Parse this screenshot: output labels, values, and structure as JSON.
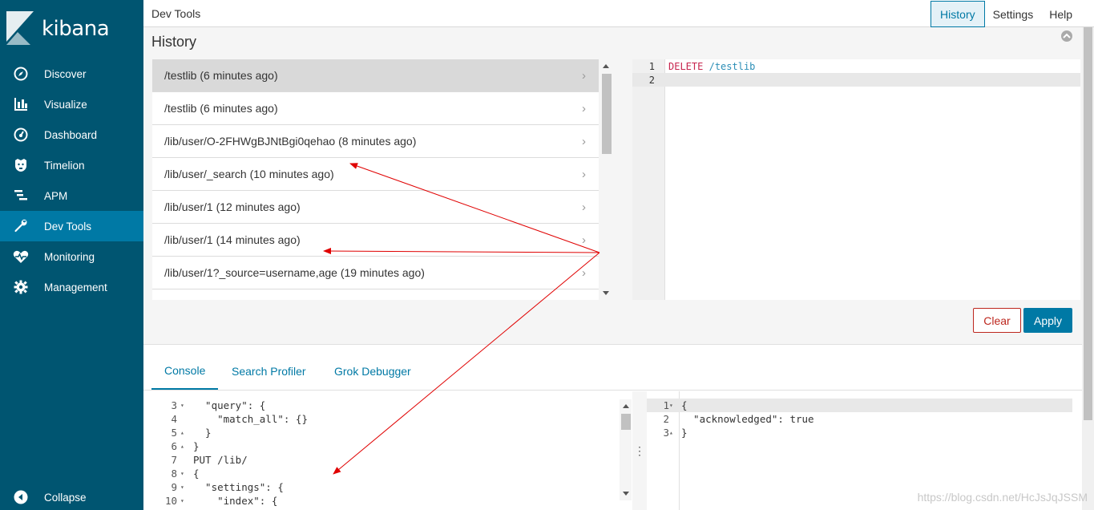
{
  "app": {
    "logo_text": "kibana"
  },
  "sidebar": {
    "items": [
      {
        "label": "Discover",
        "icon": "compass-icon"
      },
      {
        "label": "Visualize",
        "icon": "bar-chart-icon"
      },
      {
        "label": "Dashboard",
        "icon": "dashboard-icon"
      },
      {
        "label": "Timelion",
        "icon": "timelion-icon"
      },
      {
        "label": "APM",
        "icon": "apm-icon"
      },
      {
        "label": "Dev Tools",
        "icon": "wrench-icon",
        "active": true
      },
      {
        "label": "Monitoring",
        "icon": "heartbeat-icon"
      },
      {
        "label": "Management",
        "icon": "gear-icon"
      }
    ],
    "collapse_label": "Collapse"
  },
  "topbar": {
    "title": "Dev Tools",
    "nav": {
      "history": "History",
      "settings": "Settings",
      "help": "Help"
    }
  },
  "history": {
    "title": "History",
    "items": [
      "/testlib (6 minutes ago)",
      "/testlib (6 minutes ago)",
      "/lib/user/O-2FHWgBJNtBgi0qehao (8 minutes ago)",
      "/lib/user/_search (10 minutes ago)",
      "/lib/user/1 (12 minutes ago)",
      "/lib/user/1 (14 minutes ago)",
      "/lib/user/1?_source=username,age (19 minutes ago)"
    ],
    "preview": {
      "lines": [
        {
          "num": "1",
          "method": "DELETE",
          "path": "/testlib"
        },
        {
          "num": "2",
          "method": "",
          "path": ""
        }
      ]
    },
    "clear_label": "Clear",
    "apply_label": "Apply"
  },
  "tabs": {
    "console": "Console",
    "search_profiler": "Search Profiler",
    "grok_debugger": "Grok Debugger"
  },
  "editor": {
    "lines": [
      {
        "num": "3",
        "fold": "▾",
        "code": "  \"query\": {"
      },
      {
        "num": "4",
        "fold": "",
        "code": "    \"match_all\": {}"
      },
      {
        "num": "5",
        "fold": "▴",
        "code": "  }"
      },
      {
        "num": "6",
        "fold": "▴",
        "code": "}"
      },
      {
        "num": "7",
        "fold": "",
        "code": "PUT /lib/"
      },
      {
        "num": "8",
        "fold": "▾",
        "code": "{"
      },
      {
        "num": "9",
        "fold": "▾",
        "code": "  \"settings\": {"
      },
      {
        "num": "10",
        "fold": "▾",
        "code": "    \"index\": {"
      }
    ]
  },
  "output": {
    "lines": [
      {
        "num": "1",
        "fold": "▾",
        "code": "{"
      },
      {
        "num": "2",
        "fold": "",
        "code": "  \"acknowledged\": true"
      },
      {
        "num": "3",
        "fold": "▴",
        "code": "}"
      }
    ]
  },
  "watermark": "https://blog.csdn.net/HcJsJqJSSM",
  "colors": {
    "sidebar": "#005571",
    "accent": "#0079a5",
    "danger": "#bd271e",
    "annotation": "#e00000"
  }
}
